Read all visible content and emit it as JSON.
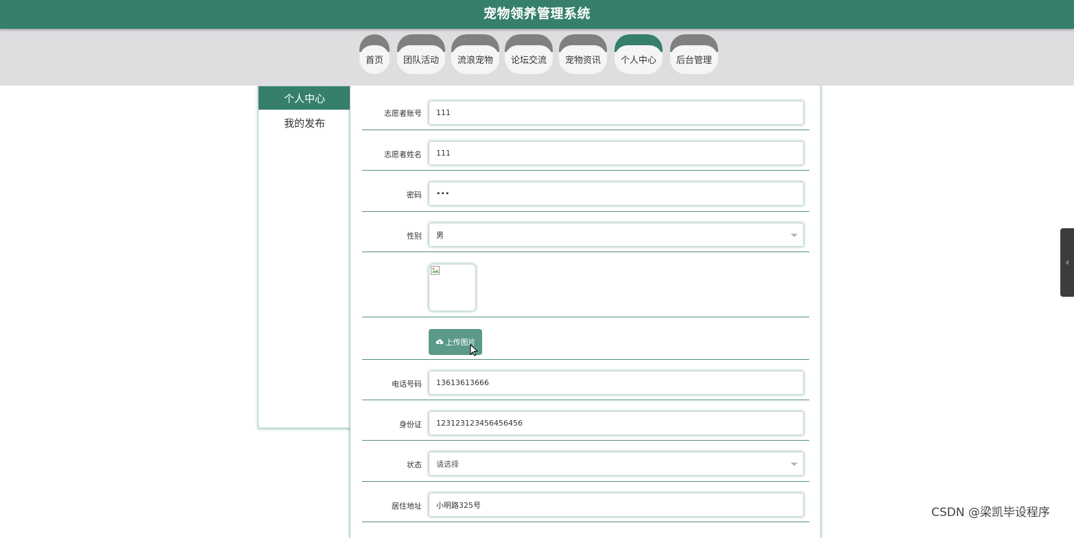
{
  "header": {
    "title": "宠物领养管理系统"
  },
  "nav": {
    "items": [
      {
        "label": "首页",
        "active": false
      },
      {
        "label": "团队活动",
        "active": false
      },
      {
        "label": "流浪宠物",
        "active": false
      },
      {
        "label": "论坛交流",
        "active": false
      },
      {
        "label": "宠物资讯",
        "active": false
      },
      {
        "label": "个人中心",
        "active": true
      },
      {
        "label": "后台管理",
        "active": false
      }
    ]
  },
  "sidebar": {
    "items": [
      {
        "label": "个人中心",
        "active": true
      },
      {
        "label": "我的发布",
        "active": false
      }
    ]
  },
  "form": {
    "account": {
      "label": "志愿者账号",
      "value": "111"
    },
    "name": {
      "label": "志愿者姓名",
      "value": "111"
    },
    "password": {
      "label": "密码",
      "value": "•••"
    },
    "gender": {
      "label": "性别",
      "value": "男"
    },
    "upload": {
      "label": "上传图片"
    },
    "phone": {
      "label": "电话号码",
      "value": "13613613666"
    },
    "id_card": {
      "label": "身份证",
      "value": "123123123456456456"
    },
    "status": {
      "label": "状态",
      "value": "请选择"
    },
    "address": {
      "label": "居住地址",
      "value": "小明路325号"
    }
  },
  "watermark": "CSDN @梁凯毕设程序",
  "colors": {
    "primary": "#36806b",
    "nav_bg": "#dedde0",
    "nav_cap": "#808080",
    "upload_btn": "#5b9a88"
  }
}
